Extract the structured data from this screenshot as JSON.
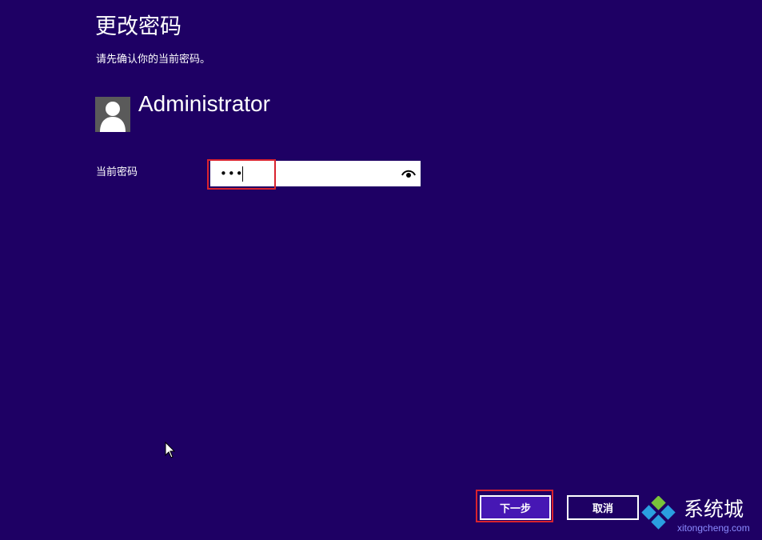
{
  "page": {
    "title": "更改密码",
    "subtitle": "请先确认你的当前密码。"
  },
  "user": {
    "name": "Administrator",
    "avatar_icon": "user-silhouette-icon"
  },
  "password_field": {
    "label": "当前密码",
    "value": "abc",
    "reveal_icon": "eye-icon"
  },
  "buttons": {
    "next_label": "下一步",
    "cancel_label": "取消"
  },
  "watermark": {
    "brand_text": "系统城",
    "url_text": "xitongcheng.com"
  },
  "colors": {
    "background": "#1e0064",
    "primary_button": "#4617b4",
    "highlight": "#d9232e"
  }
}
